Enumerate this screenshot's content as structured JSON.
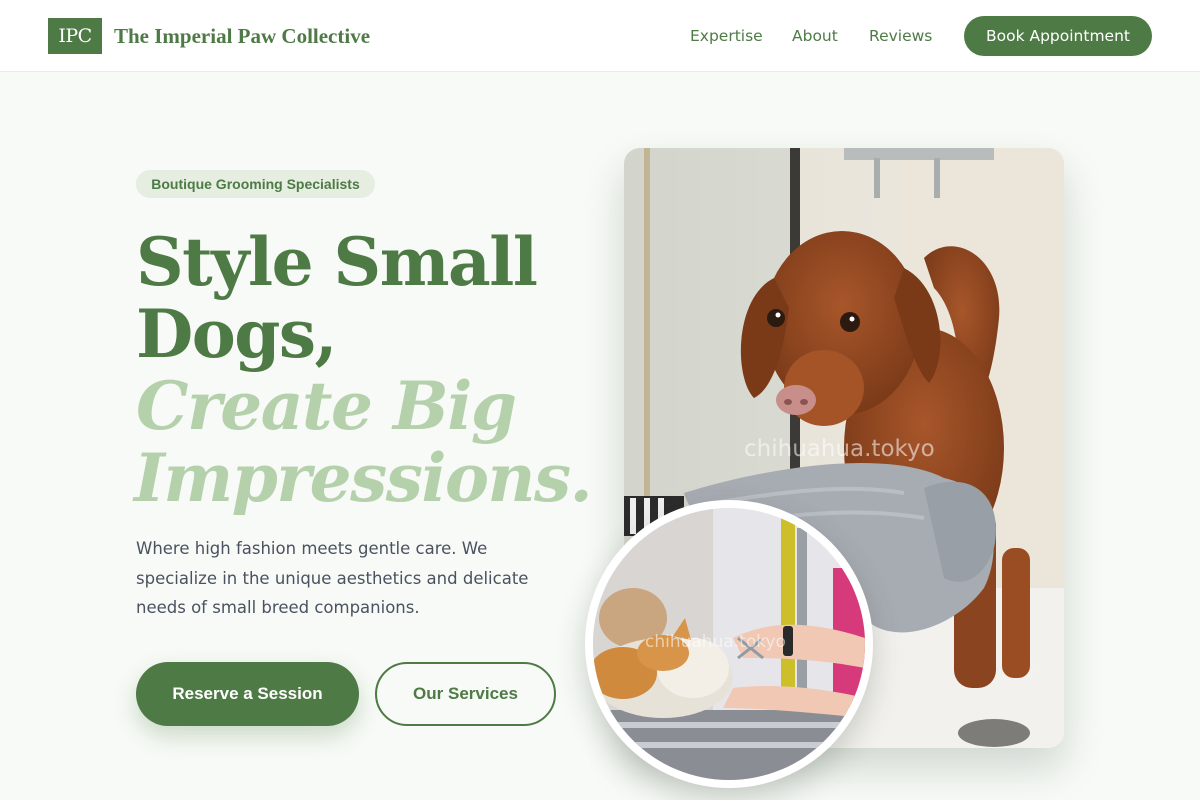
{
  "brand": {
    "logo_text": "IPC",
    "name": "The Imperial Paw Collective"
  },
  "nav": {
    "links": [
      {
        "label": "Expertise"
      },
      {
        "label": "About"
      },
      {
        "label": "Reviews"
      }
    ],
    "cta_label": "Book Appointment"
  },
  "hero": {
    "badge": "Boutique Grooming Specialists",
    "headline_lines": [
      "Style Small",
      "Dogs,",
      "Create Big",
      "Impressions."
    ],
    "description": "Where high fashion meets gentle care. We specialize in the unique aesthetics and delicate needs of small breed companions.",
    "primary_button": "Reserve a Session",
    "secondary_button": "Our Services"
  },
  "images": {
    "main_watermark": "chihuahua.tokyo",
    "round_watermark": "chihuahua.tokyo"
  },
  "colors": {
    "brand_green": "#4e7a45",
    "light_green": "#b5d1ac",
    "badge_bg": "#e5eee1",
    "page_bg": "#f7faf6"
  }
}
